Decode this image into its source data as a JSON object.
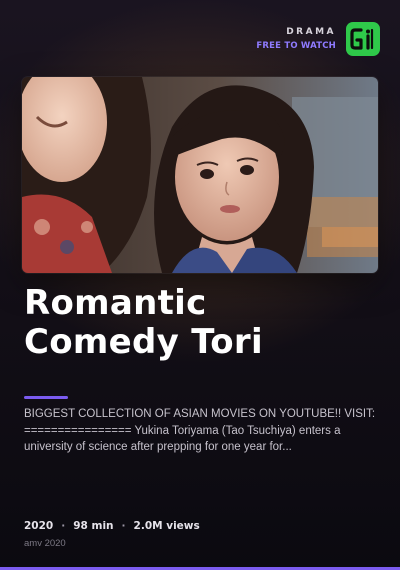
{
  "badge": {
    "genre": "DRAMA",
    "availability": "FREE TO WATCH",
    "logo_icon": "gi-logo-icon"
  },
  "video": {
    "thumbnail_icon": "video-thumbnail",
    "title": "Romantic Comedy Tori",
    "description": "BIGGEST COLLECTION OF ASIAN MOVIES ON YOUTUBE!! VISIT: ================ Yukina Toriyama (Tao Tsuchiya) enters a university of science after prepping for one year for...",
    "year": "2020",
    "duration": "98 min",
    "views": "2.0M views",
    "separator": "·",
    "channel": "amv 2020"
  },
  "colors": {
    "accent": "#7b5cf0",
    "logo_bg": "#2fc94a",
    "free_text": "#8f7bff"
  }
}
